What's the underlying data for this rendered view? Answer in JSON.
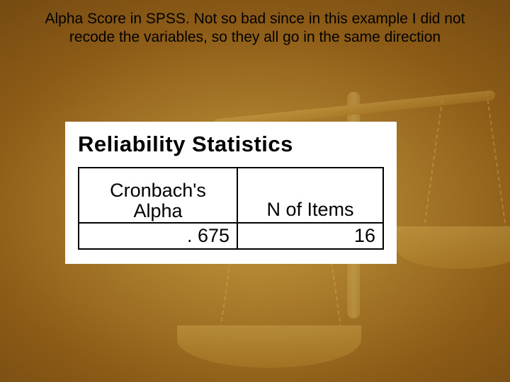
{
  "slide": {
    "title": "Alpha Score in SPSS. Not so bad since in this example I did not recode the variables, so they all go in the same direction"
  },
  "panel": {
    "heading": "Reliability Statistics",
    "columns": {
      "alpha_label_line1": "Cronbach's",
      "alpha_label_line2": "Alpha",
      "nitems_label": "N of Items"
    },
    "values": {
      "cronbach_alpha": ". 675",
      "n_items": "16"
    }
  },
  "decor": {
    "icon": "balance-scale-icon"
  }
}
